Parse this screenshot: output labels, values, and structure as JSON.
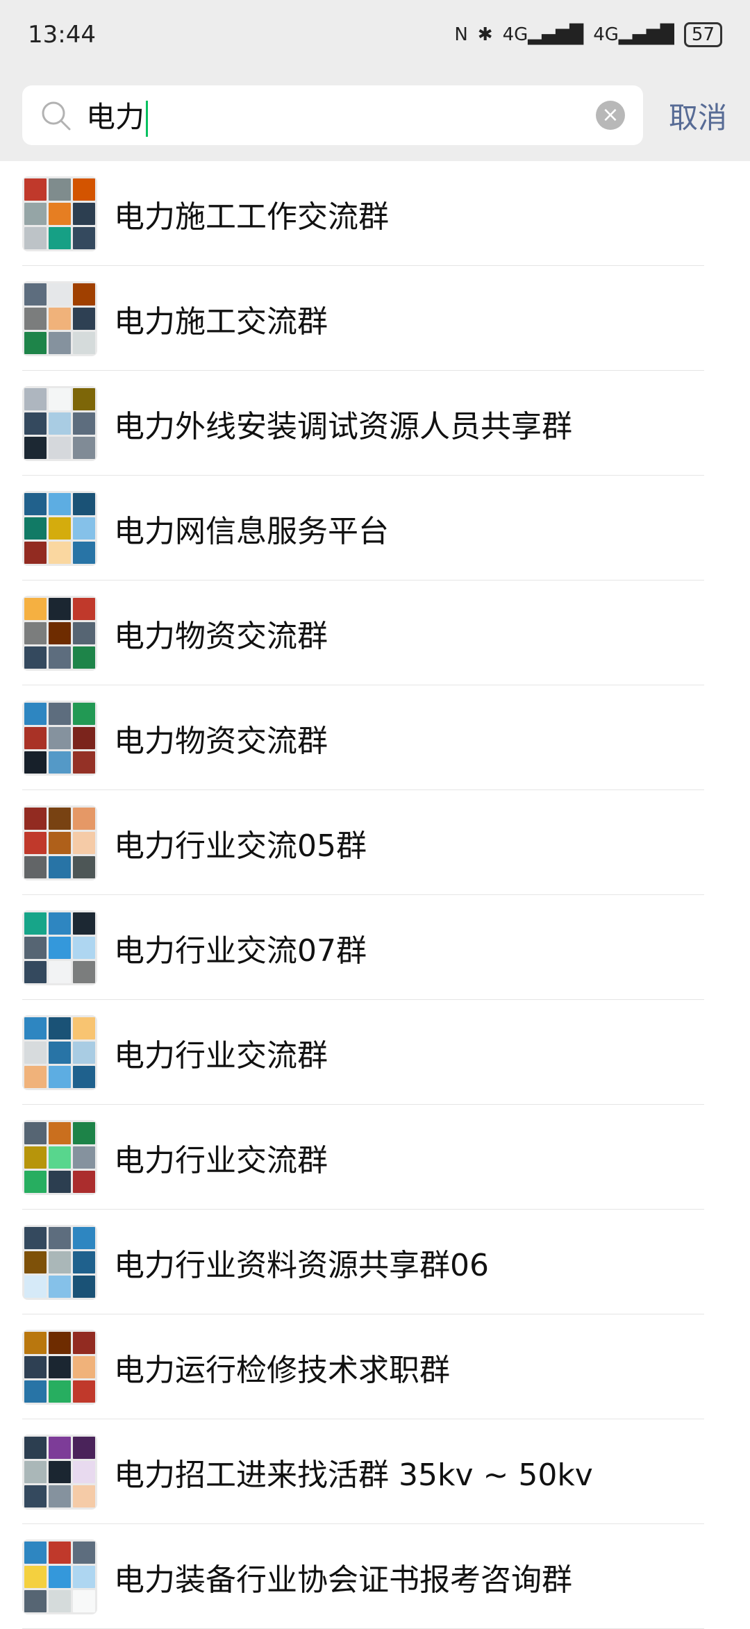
{
  "status": {
    "time": "13:44",
    "icons": [
      "nfc-icon",
      "bluetooth-icon",
      "signal-4g-icon",
      "signal-4g-icon"
    ],
    "nfc_glyph": "N",
    "bt_glyph": "✱",
    "signal1": "4G▂▄▆█",
    "signal2": "4G▂▄▆█",
    "battery": "57"
  },
  "search": {
    "value": "电力",
    "cancel_label": "取消"
  },
  "results": [
    {
      "name": "电力施工工作交流群",
      "colors": [
        "#c0392b",
        "#7f8c8d",
        "#d35400",
        "#95a5a6",
        "#e67e22",
        "#2c3e50",
        "#bdc3c7",
        "#16a085",
        "#34495e"
      ]
    },
    {
      "name": "电力施工交流群",
      "colors": [
        "#5d6d7e",
        "#e5e7e9",
        "#a04000",
        "#7b7d7d",
        "#f0b27a",
        "#2e4053",
        "#1e8449",
        "#85929e",
        "#d5dbdb"
      ]
    },
    {
      "name": "电力外线安装调试资源人员共享群",
      "colors": [
        "#aeb6bf",
        "#f4f6f6",
        "#7d6608",
        "#34495e",
        "#a9cce3",
        "#5d6d7e",
        "#1c2833",
        "#d5d8dc",
        "#808b96"
      ]
    },
    {
      "name": "电力网信息服务平台",
      "colors": [
        "#21618c",
        "#5dade2",
        "#1a5276",
        "#117a65",
        "#d4ac0d",
        "#85c1e9",
        "#922b21",
        "#fad7a0",
        "#2874a6"
      ]
    },
    {
      "name": "电力物资交流群",
      "colors": [
        "#f5b041",
        "#1b2631",
        "#c0392b",
        "#7b7d7d",
        "#6e2c00",
        "#566573",
        "#34495e",
        "#5d6d7e",
        "#1e8449"
      ]
    },
    {
      "name": "电力物资交流群",
      "colors": [
        "#2e86c1",
        "#5d6d7e",
        "#229954",
        "#a93226",
        "#85929e",
        "#7b241c",
        "#17202a",
        "#5499c7",
        "#943126"
      ]
    },
    {
      "name": "电力行业交流05群",
      "colors": [
        "#922b21",
        "#784212",
        "#e59866",
        "#c0392b",
        "#af601a",
        "#f5cba7",
        "#626567",
        "#2874a6",
        "#4d5656"
      ]
    },
    {
      "name": "电力行业交流07群",
      "colors": [
        "#17a589",
        "#2e86c1",
        "#1c2833",
        "#566573",
        "#3498db",
        "#aed6f1",
        "#34495e",
        "#f2f3f4",
        "#7b7d7d"
      ]
    },
    {
      "name": "电力行业交流群",
      "colors": [
        "#2e86c1",
        "#1a5276",
        "#f8c471",
        "#d7dbdd",
        "#2874a6",
        "#a9cce3",
        "#f0b27a",
        "#5dade2",
        "#1f618d"
      ]
    },
    {
      "name": "电力行业交流群",
      "colors": [
        "#566573",
        "#ca6f1e",
        "#1d8348",
        "#b7950b",
        "#58d68d",
        "#85929e",
        "#27ae60",
        "#2c3e50",
        "#ab2d2d"
      ]
    },
    {
      "name": "电力行业资料资源共享群06",
      "colors": [
        "#34495e",
        "#5d6d7e",
        "#2e86c1",
        "#7e5109",
        "#aab7b8",
        "#1f618d",
        "#d6eaf8",
        "#85c1e9",
        "#1a5276"
      ]
    },
    {
      "name": "电力运行检修技术求职群",
      "colors": [
        "#b9770e",
        "#6e2c00",
        "#922b21",
        "#2e4053",
        "#1b2631",
        "#f0b27a",
        "#2874a6",
        "#27ae60",
        "#c0392b"
      ]
    },
    {
      "name": "电力招工进来找活群 35kv ~ 50kv",
      "colors": [
        "#2c3e50",
        "#7d3c98",
        "#4a235a",
        "#aab7b8",
        "#1b2631",
        "#e8daef",
        "#34495e",
        "#85929e",
        "#f5cba7"
      ]
    },
    {
      "name": "电力装备行业协会证书报考咨询群",
      "colors": [
        "#2e86c1",
        "#c0392b",
        "#5d6d7e",
        "#f4d03f",
        "#3498db",
        "#aed6f1",
        "#566573",
        "#d5dbdb",
        "#f8f9f9"
      ]
    }
  ]
}
